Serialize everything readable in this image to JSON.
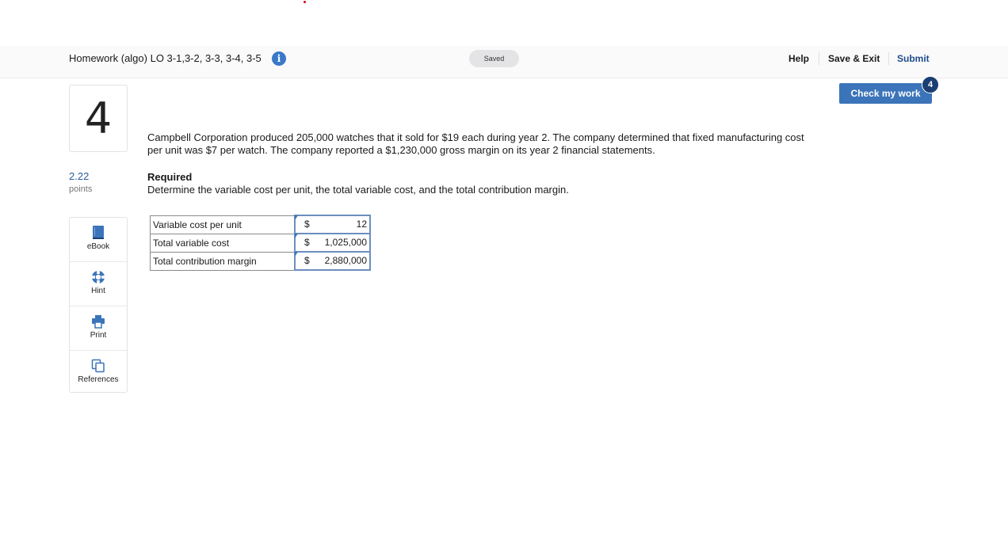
{
  "header": {
    "title": "Homework (algo) LO 3-1,3-2, 3-3, 3-4, 3-5",
    "saved_status": "Saved",
    "help_label": "Help",
    "save_exit_label": "Save & Exit",
    "submit_label": "Submit"
  },
  "question": {
    "number": "4",
    "points_value": "2.22",
    "points_label": "points",
    "problem_text": "Campbell Corporation produced 205,000 watches that it sold for $19 each during year 2. The company determined that fixed manufacturing cost per unit was $7 per watch. The company reported a $1,230,000 gross margin on its year 2 financial statements.",
    "required_heading": "Required",
    "required_text": "Determine the variable cost per unit, the total variable cost, and the total contribution margin."
  },
  "check_work": {
    "label": "Check my work",
    "badge_count": "4"
  },
  "tools": [
    {
      "label": "eBook",
      "icon": "book-icon"
    },
    {
      "label": "Hint",
      "icon": "lifebuoy-icon"
    },
    {
      "label": "Print",
      "icon": "printer-icon"
    },
    {
      "label": "References",
      "icon": "copy-pages-icon"
    }
  ],
  "answer_table": {
    "rows": [
      {
        "label": "Variable cost per unit",
        "currency": "$",
        "value": "12"
      },
      {
        "label": "Total variable cost",
        "currency": "$",
        "value": "1,025,000"
      },
      {
        "label": "Total contribution margin",
        "currency": "$",
        "value": "2,880,000"
      }
    ]
  },
  "colors": {
    "accent": "#3b74b9",
    "submit_link": "#1e4d8c",
    "badge": "#1b3f73",
    "points": "#2b5c9c"
  }
}
